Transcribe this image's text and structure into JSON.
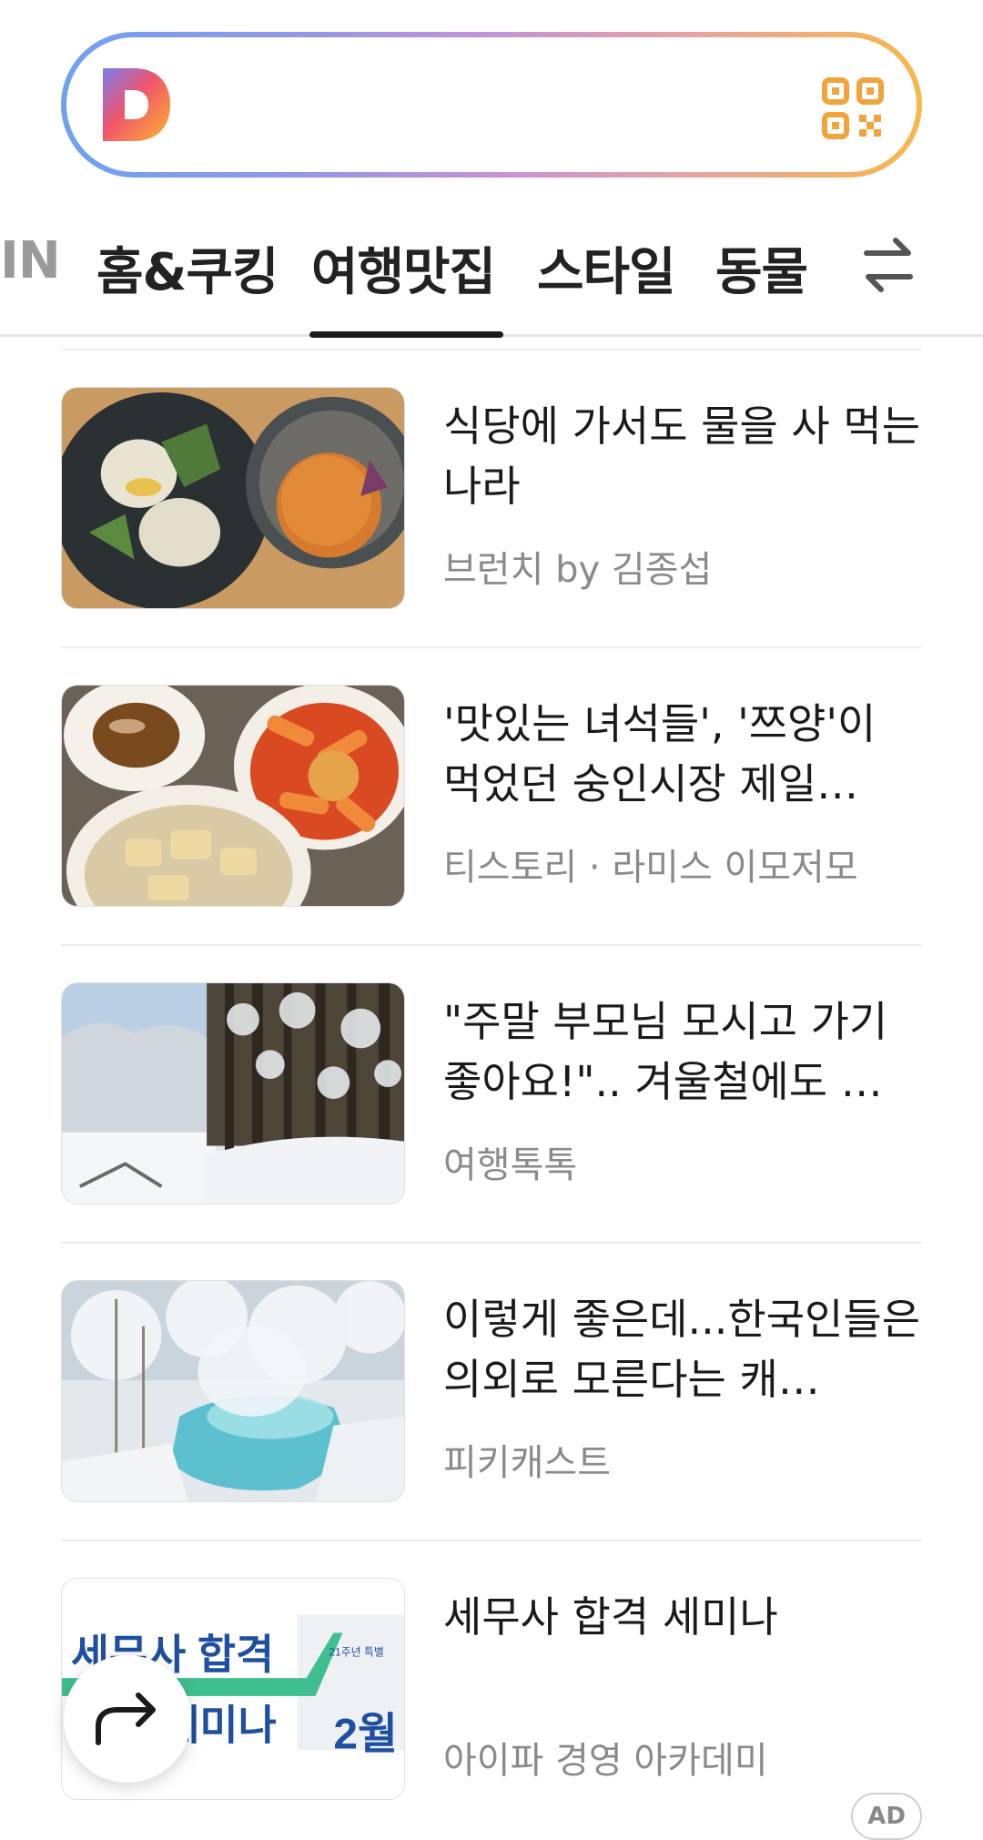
{
  "search": {
    "logo_letter": "D",
    "qr_icon": "qr-code-icon"
  },
  "tabs": [
    {
      "label": "IN",
      "active": false
    },
    {
      "label": "홈&쿠킹",
      "active": false
    },
    {
      "label": "여행맛집",
      "active": true
    },
    {
      "label": "스타일",
      "active": false
    },
    {
      "label": "동물",
      "active": false
    }
  ],
  "tab_swap_icon": "swap-arrows-icon",
  "feed": [
    {
      "title": "식당에 가서도 물을 사 먹는 나라",
      "source": "브런치 by 김종섭",
      "thumb": "brunch-food-photo"
    },
    {
      "title": "'맛있는 녀석들', '쯔양'이 먹었던 숭인시장 제일…",
      "source": "티스토리 · 라미스 이모저모",
      "thumb": "tteokbokki-photo"
    },
    {
      "title": "\"주말 부모님 모시고 가기 좋아요!\".. 겨울철에도 …",
      "source": "여행톡톡",
      "thumb": "snowy-forest-photo"
    },
    {
      "title": "이렇게 좋은데...한국인들은 의외로 모른다는 캐…",
      "source": "피키캐스트",
      "thumb": "hot-spring-snow-photo"
    },
    {
      "title": "세무사 합격 세미나",
      "source": "아이파 경영 아카데미",
      "thumb": "seminar-ad-banner",
      "ad": "AD"
    }
  ],
  "ad_banner": {
    "text1": "세무사 합격",
    "text2": "세미나",
    "month": "2월",
    "small": "21주년 특별"
  },
  "fab_icon": "share-arrow-icon",
  "colors": {
    "accent": "#1b1b1b",
    "source_text": "#8a8a8a"
  }
}
